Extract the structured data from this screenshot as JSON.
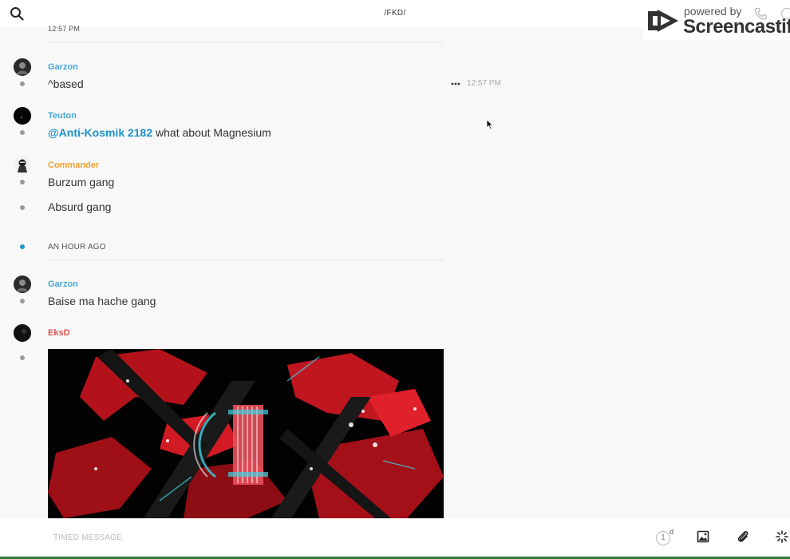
{
  "header": {
    "channel_title": "/FKD/"
  },
  "watermark": {
    "powered_by": "powered by",
    "brand": "Screencastify"
  },
  "timeline": {
    "top_timestamp": "12:57 PM",
    "time_separator": "AN HOUR AGO"
  },
  "messages": [
    {
      "user": "Garzon",
      "user_color": "#4aa6d6",
      "text": "^based",
      "hover_time": "12:57 PM"
    },
    {
      "user": "Teuton",
      "user_color": "#4aa6d6",
      "mention": "@Anti-Kosmik 2182",
      "text": " what about Magnesium"
    },
    {
      "user": "Commander",
      "user_color": "#f0a030",
      "lines": [
        "Burzum gang",
        "Absurd gang"
      ]
    },
    {
      "user": "Garzon",
      "user_color": "#4aa6d6",
      "text": "Baise ma hache gang"
    },
    {
      "user": "EksD",
      "user_color": "#d9534f",
      "attachment": "image"
    }
  ],
  "composer": {
    "placeholder": "TIMED MESSAGE",
    "timer_value": "1",
    "timer_unit": "d"
  },
  "icons": [
    "search-icon",
    "phone-icon",
    "info-icon",
    "more-icon",
    "image-icon",
    "paperclip-icon",
    "sparkle-icon"
  ]
}
